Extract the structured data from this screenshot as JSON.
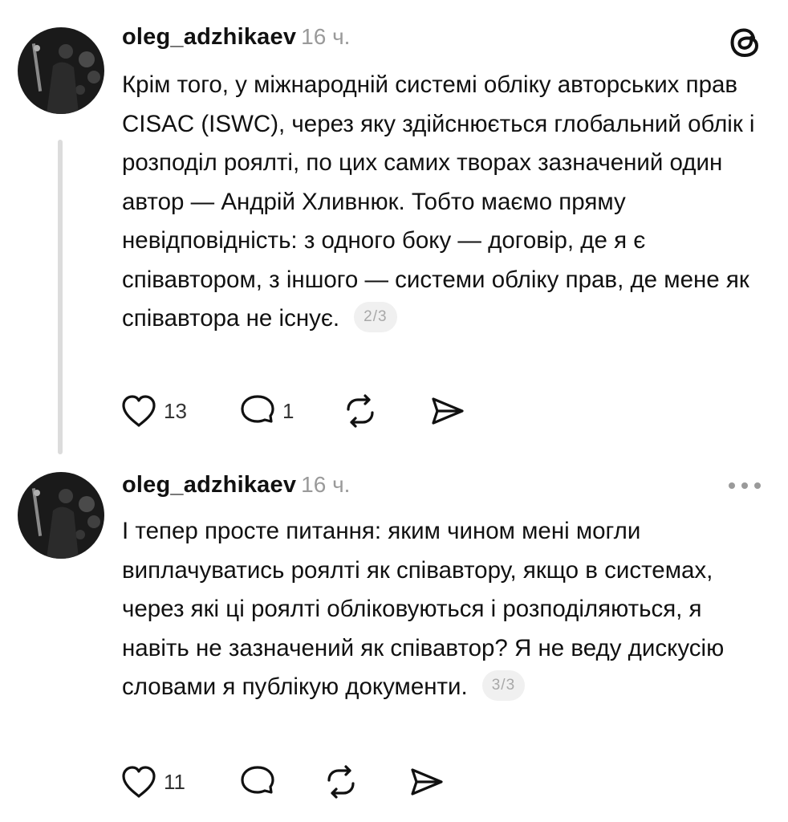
{
  "posts": [
    {
      "username": "oleg_adzhikaev",
      "time": "16 ч.",
      "corner_icon": "threads-logo-icon",
      "text": "Крім того, у міжнародній системі обліку авторських прав CISAC (ISWC), через яку здійснюється глобальний облік і розподіл роялті, по цих самих творах зазначений один автор — Андрій Хливнюк. Тобто маємо пряму невідповідність: з одного боку — договір, де я є співавтором, з іншого — системи обліку прав, де мене як співавтора не існує.",
      "page_badge": "2/3",
      "likes": "13",
      "replies": "1"
    },
    {
      "username": "oleg_adzhikaev",
      "time": "16 ч.",
      "corner_icon": "more-icon",
      "text": "І тепер просте питання: яким чином мені могли виплачуватись роялті як співавтору, якщо в системах, через які ці роялті обліковуються і розподіляються, я навіть не зазначений як співавтор? Я не веду дискусію словами я публікую документи.",
      "page_badge": "3/3",
      "likes": "11",
      "replies": ""
    }
  ],
  "colors": {
    "text": "#111111",
    "muted": "#9a9a9a",
    "thread_line": "#dcdcdc",
    "badge_bg": "#f0f0f0"
  }
}
